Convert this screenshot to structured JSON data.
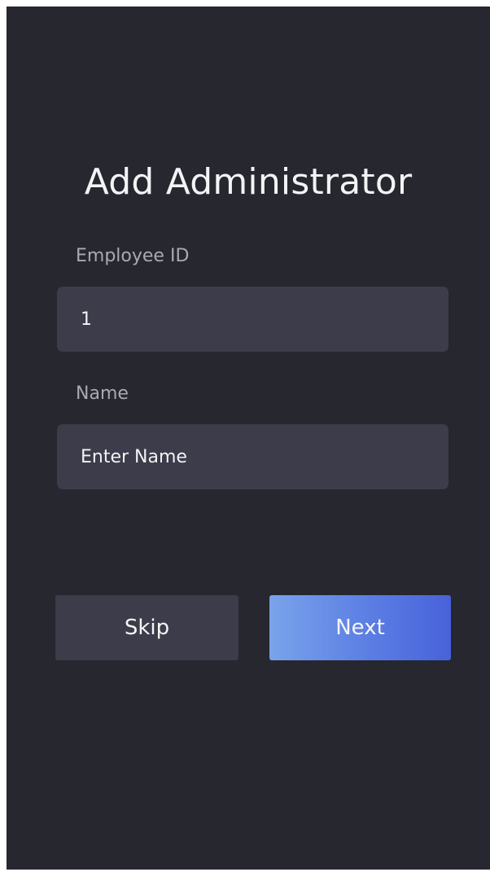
{
  "screen": {
    "title": "Add Administrator"
  },
  "form": {
    "employee_id": {
      "label": "Employee ID",
      "value": "1"
    },
    "name": {
      "label": "Name",
      "value": "",
      "placeholder": "Enter Name"
    }
  },
  "actions": {
    "skip_label": "Skip",
    "next_label": "Next"
  },
  "colors": {
    "background": "#26272f",
    "field": "#3c3c4a",
    "accent_start": "#79a3ea",
    "accent_end": "#4862d9"
  }
}
